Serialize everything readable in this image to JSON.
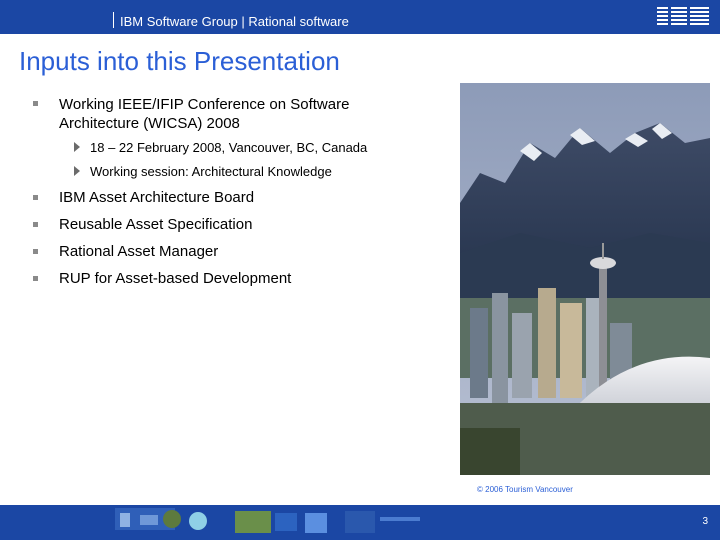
{
  "header": {
    "title": "IBM Software Group | Rational software",
    "logo_text": "IBM"
  },
  "slide": {
    "title": "Inputs into this Presentation",
    "bullets": [
      {
        "text_line1": "Working IEEE/IFIP Conference on Software",
        "text_line2": "Architecture (WICSA) 2008",
        "sub": [
          "18 – 22 February 2008, Vancouver, BC, Canada",
          "Working session: Architectural Knowledge"
        ]
      },
      {
        "text": "IBM Asset Architecture Board"
      },
      {
        "text": "Reusable Asset Specification"
      },
      {
        "text": "Rational Asset Manager"
      },
      {
        "text": "RUP for Asset-based Development"
      }
    ],
    "photo_caption": "© 2006 Tourism Vancouver"
  },
  "footer": {
    "page_number": "3"
  },
  "colors": {
    "brand_blue": "#1b47a4",
    "title_blue": "#2b5fd6"
  }
}
